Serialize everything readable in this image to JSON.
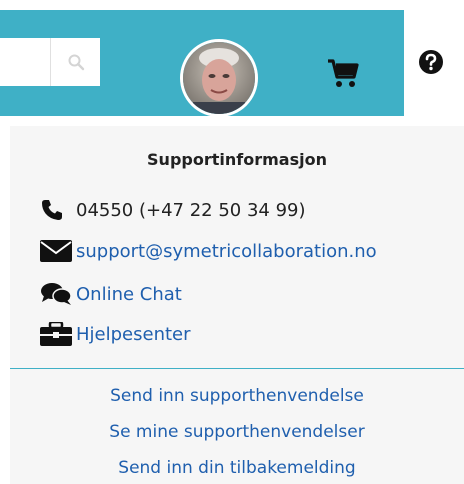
{
  "header": {
    "search": {
      "value": "",
      "placeholder": ""
    },
    "icons": {
      "search": "search-icon",
      "cart": "cart-icon",
      "help": "help-icon"
    },
    "accent_color": "#3fb0c6"
  },
  "support": {
    "title": "Supportinformasjon",
    "phone": "04550 (+47 22 50 34 99)",
    "email": "support@symetricollaboration.no",
    "chat": "Online Chat",
    "help_center": "Hjelpesenter",
    "actions": [
      "Send inn supporthenvendelse",
      "Se mine supporthenvendelser",
      "Send inn din tilbakemelding"
    ],
    "link_color": "#1f5fae"
  }
}
